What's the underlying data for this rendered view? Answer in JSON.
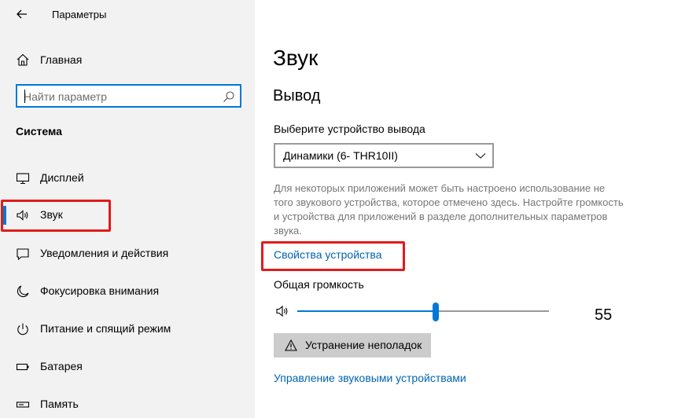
{
  "window": {
    "title": "Параметры"
  },
  "sidebar": {
    "home_label": "Главная",
    "search_placeholder": "Найти параметр",
    "section_title": "Система",
    "items": [
      {
        "label": "Дисплей",
        "icon": "monitor-icon"
      },
      {
        "label": "Звук",
        "icon": "speaker-icon",
        "selected": true
      },
      {
        "label": "Уведомления и действия",
        "icon": "notification-icon"
      },
      {
        "label": "Фокусировка внимания",
        "icon": "moon-icon"
      },
      {
        "label": "Питание и спящий режим",
        "icon": "power-icon"
      },
      {
        "label": "Батарея",
        "icon": "battery-icon"
      },
      {
        "label": "Память",
        "icon": "storage-icon"
      }
    ]
  },
  "main": {
    "title": "Звук",
    "output_title": "Вывод",
    "device_label": "Выберите устройство вывода",
    "device_selected": "Динамики (6- THR10II)",
    "help_text": "Для некоторых приложений может быть настроено использование не того звукового устройства, которое отмечено здесь. Настройте громкость и устройства для приложений в разделе дополнительных параметров звука.",
    "device_properties_link": "Свойства устройства",
    "volume_label": "Общая громкость",
    "volume_value": "55",
    "volume_level": 0.55,
    "troubleshoot_label": "Устранение неполадок",
    "manage_devices_link": "Управление звуковыми устройствами"
  },
  "colors": {
    "accent": "#0078d7",
    "link": "#0063b1",
    "highlight_box": "#e01b1b",
    "sidebar_bg": "#f2f2f2"
  }
}
